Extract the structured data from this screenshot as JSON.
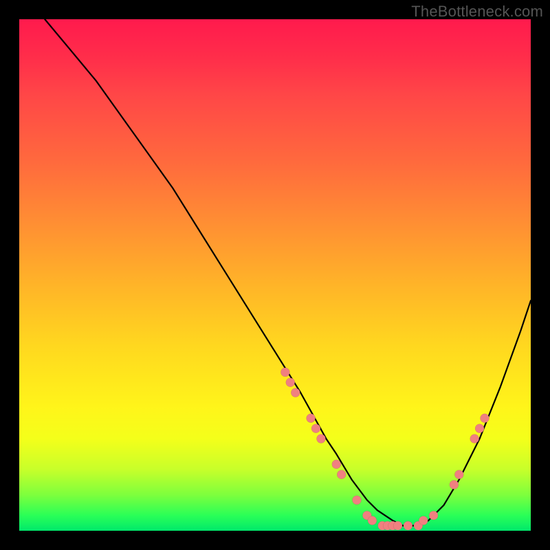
{
  "watermark": "TheBottleneck.com",
  "colors": {
    "frame": "#000000",
    "dot": "#f08080",
    "curve": "#000000"
  },
  "chart_data": {
    "type": "line",
    "title": "",
    "xlabel": "",
    "ylabel": "",
    "xlim": [
      0,
      100
    ],
    "ylim": [
      0,
      100
    ],
    "grid": false,
    "legend": false,
    "series": [
      {
        "name": "bottleneck-curve",
        "x": [
          5,
          10,
          15,
          20,
          25,
          30,
          35,
          40,
          45,
          50,
          55,
          60,
          62,
          65,
          68,
          70,
          73,
          75,
          78,
          80,
          83,
          86,
          90,
          94,
          98,
          100
        ],
        "y": [
          100,
          94,
          88,
          81,
          74,
          67,
          59,
          51,
          43,
          35,
          27,
          18,
          15,
          10,
          6,
          4,
          2,
          1,
          1,
          2,
          5,
          10,
          18,
          28,
          39,
          45
        ]
      }
    ],
    "points": [
      {
        "name": "p1",
        "x": 52,
        "y": 31
      },
      {
        "name": "p2",
        "x": 53,
        "y": 29
      },
      {
        "name": "p3",
        "x": 54,
        "y": 27
      },
      {
        "name": "p4",
        "x": 57,
        "y": 22
      },
      {
        "name": "p5",
        "x": 58,
        "y": 20
      },
      {
        "name": "p6",
        "x": 59,
        "y": 18
      },
      {
        "name": "p7",
        "x": 62,
        "y": 13
      },
      {
        "name": "p8",
        "x": 63,
        "y": 11
      },
      {
        "name": "p9",
        "x": 66,
        "y": 6
      },
      {
        "name": "p10",
        "x": 68,
        "y": 3
      },
      {
        "name": "p11",
        "x": 69,
        "y": 2
      },
      {
        "name": "p12",
        "x": 71,
        "y": 1
      },
      {
        "name": "p13",
        "x": 72,
        "y": 1
      },
      {
        "name": "p14",
        "x": 73,
        "y": 1
      },
      {
        "name": "p15",
        "x": 74,
        "y": 1
      },
      {
        "name": "p16",
        "x": 76,
        "y": 1
      },
      {
        "name": "p17",
        "x": 78,
        "y": 1
      },
      {
        "name": "p18",
        "x": 79,
        "y": 2
      },
      {
        "name": "p19",
        "x": 81,
        "y": 3
      },
      {
        "name": "p20",
        "x": 85,
        "y": 9
      },
      {
        "name": "p21",
        "x": 86,
        "y": 11
      },
      {
        "name": "p22",
        "x": 89,
        "y": 18
      },
      {
        "name": "p23",
        "x": 90,
        "y": 20
      },
      {
        "name": "p24",
        "x": 91,
        "y": 22
      }
    ]
  }
}
